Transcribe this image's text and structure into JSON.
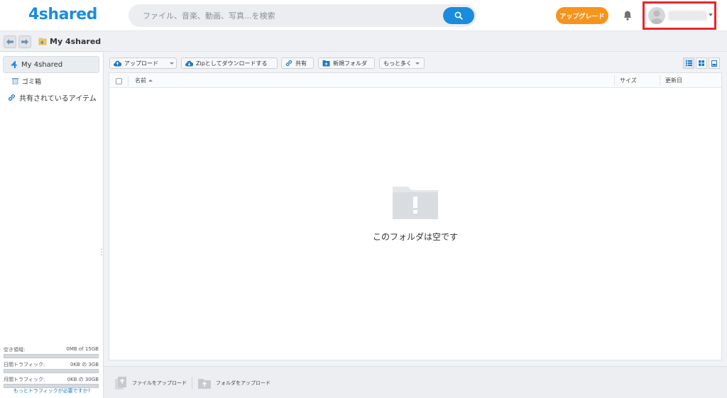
{
  "header": {
    "logo": "4shared",
    "search_placeholder": "ファイル、音楽、動画、写真...を検索",
    "upgrade_label": "アップグレード",
    "accent": "#1a8ce0",
    "upgrade_color": "#f7941d",
    "highlight_color": "#e8262c"
  },
  "breadcrumb": {
    "title": "My 4shared"
  },
  "sidebar": {
    "items": [
      {
        "label": "My 4shared",
        "icon": "4shared-logo-icon"
      },
      {
        "label": "ゴミ箱",
        "icon": "trash-icon"
      },
      {
        "label": "共有されているアイテム",
        "icon": "link-icon"
      }
    ],
    "quota": [
      {
        "label": "空き領域:",
        "value": "0MB of 15GB",
        "fill": 0
      },
      {
        "label": "日間トラフィック:",
        "value": "0KB の 3GB",
        "fill": 0
      },
      {
        "label": "月間トラフィック:",
        "value": "0KB の 30GB",
        "fill": 0
      }
    ],
    "more_traffic": "もっとトラフィックが必要ですか?"
  },
  "toolbar": {
    "upload": "アップロード",
    "zip_download": "Zipとしてダウンロードする",
    "share": "共有",
    "new_folder": "新規フォルダ",
    "more": "もっと多く"
  },
  "table": {
    "columns": {
      "name": "名前",
      "size": "サイズ",
      "updated": "更新日"
    },
    "empty_message": "このフォルダは空です"
  },
  "bottombar": {
    "upload_file": "ファイルをアップロード",
    "upload_folder": "フォルダをアップロード"
  }
}
